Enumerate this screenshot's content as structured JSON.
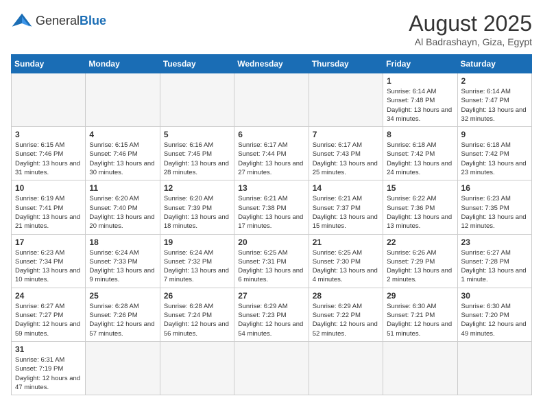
{
  "header": {
    "logo_general": "General",
    "logo_blue": "Blue",
    "title": "August 2025",
    "subtitle": "Al Badrashayn, Giza, Egypt"
  },
  "days_of_week": [
    "Sunday",
    "Monday",
    "Tuesday",
    "Wednesday",
    "Thursday",
    "Friday",
    "Saturday"
  ],
  "weeks": [
    [
      {
        "day": "",
        "info": ""
      },
      {
        "day": "",
        "info": ""
      },
      {
        "day": "",
        "info": ""
      },
      {
        "day": "",
        "info": ""
      },
      {
        "day": "",
        "info": ""
      },
      {
        "day": "1",
        "info": "Sunrise: 6:14 AM\nSunset: 7:48 PM\nDaylight: 13 hours and 34 minutes."
      },
      {
        "day": "2",
        "info": "Sunrise: 6:14 AM\nSunset: 7:47 PM\nDaylight: 13 hours and 32 minutes."
      }
    ],
    [
      {
        "day": "3",
        "info": "Sunrise: 6:15 AM\nSunset: 7:46 PM\nDaylight: 13 hours and 31 minutes."
      },
      {
        "day": "4",
        "info": "Sunrise: 6:15 AM\nSunset: 7:46 PM\nDaylight: 13 hours and 30 minutes."
      },
      {
        "day": "5",
        "info": "Sunrise: 6:16 AM\nSunset: 7:45 PM\nDaylight: 13 hours and 28 minutes."
      },
      {
        "day": "6",
        "info": "Sunrise: 6:17 AM\nSunset: 7:44 PM\nDaylight: 13 hours and 27 minutes."
      },
      {
        "day": "7",
        "info": "Sunrise: 6:17 AM\nSunset: 7:43 PM\nDaylight: 13 hours and 25 minutes."
      },
      {
        "day": "8",
        "info": "Sunrise: 6:18 AM\nSunset: 7:42 PM\nDaylight: 13 hours and 24 minutes."
      },
      {
        "day": "9",
        "info": "Sunrise: 6:18 AM\nSunset: 7:42 PM\nDaylight: 13 hours and 23 minutes."
      }
    ],
    [
      {
        "day": "10",
        "info": "Sunrise: 6:19 AM\nSunset: 7:41 PM\nDaylight: 13 hours and 21 minutes."
      },
      {
        "day": "11",
        "info": "Sunrise: 6:20 AM\nSunset: 7:40 PM\nDaylight: 13 hours and 20 minutes."
      },
      {
        "day": "12",
        "info": "Sunrise: 6:20 AM\nSunset: 7:39 PM\nDaylight: 13 hours and 18 minutes."
      },
      {
        "day": "13",
        "info": "Sunrise: 6:21 AM\nSunset: 7:38 PM\nDaylight: 13 hours and 17 minutes."
      },
      {
        "day": "14",
        "info": "Sunrise: 6:21 AM\nSunset: 7:37 PM\nDaylight: 13 hours and 15 minutes."
      },
      {
        "day": "15",
        "info": "Sunrise: 6:22 AM\nSunset: 7:36 PM\nDaylight: 13 hours and 13 minutes."
      },
      {
        "day": "16",
        "info": "Sunrise: 6:23 AM\nSunset: 7:35 PM\nDaylight: 13 hours and 12 minutes."
      }
    ],
    [
      {
        "day": "17",
        "info": "Sunrise: 6:23 AM\nSunset: 7:34 PM\nDaylight: 13 hours and 10 minutes."
      },
      {
        "day": "18",
        "info": "Sunrise: 6:24 AM\nSunset: 7:33 PM\nDaylight: 13 hours and 9 minutes."
      },
      {
        "day": "19",
        "info": "Sunrise: 6:24 AM\nSunset: 7:32 PM\nDaylight: 13 hours and 7 minutes."
      },
      {
        "day": "20",
        "info": "Sunrise: 6:25 AM\nSunset: 7:31 PM\nDaylight: 13 hours and 6 minutes."
      },
      {
        "day": "21",
        "info": "Sunrise: 6:25 AM\nSunset: 7:30 PM\nDaylight: 13 hours and 4 minutes."
      },
      {
        "day": "22",
        "info": "Sunrise: 6:26 AM\nSunset: 7:29 PM\nDaylight: 13 hours and 2 minutes."
      },
      {
        "day": "23",
        "info": "Sunrise: 6:27 AM\nSunset: 7:28 PM\nDaylight: 13 hours and 1 minute."
      }
    ],
    [
      {
        "day": "24",
        "info": "Sunrise: 6:27 AM\nSunset: 7:27 PM\nDaylight: 12 hours and 59 minutes."
      },
      {
        "day": "25",
        "info": "Sunrise: 6:28 AM\nSunset: 7:26 PM\nDaylight: 12 hours and 57 minutes."
      },
      {
        "day": "26",
        "info": "Sunrise: 6:28 AM\nSunset: 7:24 PM\nDaylight: 12 hours and 56 minutes."
      },
      {
        "day": "27",
        "info": "Sunrise: 6:29 AM\nSunset: 7:23 PM\nDaylight: 12 hours and 54 minutes."
      },
      {
        "day": "28",
        "info": "Sunrise: 6:29 AM\nSunset: 7:22 PM\nDaylight: 12 hours and 52 minutes."
      },
      {
        "day": "29",
        "info": "Sunrise: 6:30 AM\nSunset: 7:21 PM\nDaylight: 12 hours and 51 minutes."
      },
      {
        "day": "30",
        "info": "Sunrise: 6:30 AM\nSunset: 7:20 PM\nDaylight: 12 hours and 49 minutes."
      }
    ],
    [
      {
        "day": "31",
        "info": "Sunrise: 6:31 AM\nSunset: 7:19 PM\nDaylight: 12 hours and 47 minutes."
      },
      {
        "day": "",
        "info": ""
      },
      {
        "day": "",
        "info": ""
      },
      {
        "day": "",
        "info": ""
      },
      {
        "day": "",
        "info": ""
      },
      {
        "day": "",
        "info": ""
      },
      {
        "day": "",
        "info": ""
      }
    ]
  ]
}
